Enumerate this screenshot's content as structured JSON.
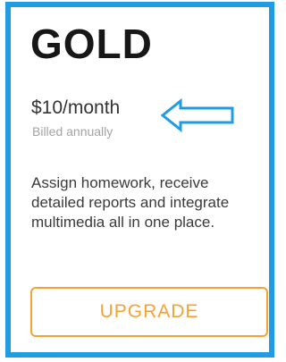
{
  "plan": {
    "name": "GOLD",
    "price": "$10/month",
    "billing": "Billed annually",
    "description": "Assign homework, receive detailed reports and integrate multimedia all in one place.",
    "button_label": "UPGRADE"
  },
  "annotation": {
    "icon": "left-arrow-icon",
    "color": "#1f9ce4"
  },
  "colors": {
    "border": "#1f9ce4",
    "accent": "#f6a233",
    "heading": "#171717"
  }
}
